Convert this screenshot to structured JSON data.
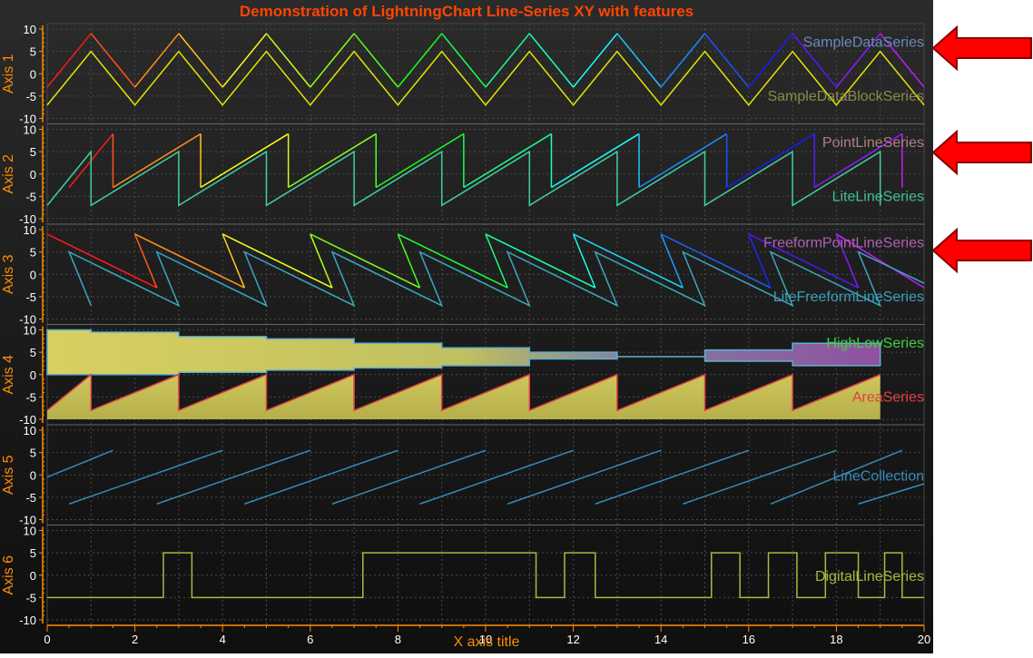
{
  "chart_data": {
    "type": "line",
    "title": "Demonstration of LightningChart Line-Series XY with features",
    "xlabel": "X axis title",
    "xlim": [
      0,
      20
    ],
    "x_ticks": [
      "0",
      "2",
      "4",
      "6",
      "8",
      "10",
      "12",
      "14",
      "16",
      "18",
      "20"
    ],
    "y_ticks": [
      "10",
      "5",
      "0",
      "-5",
      "-10"
    ],
    "grid": true,
    "colors": {
      "accent": "#ff7f00",
      "title": "#ff4500",
      "background": "#1e1e1e",
      "arrow": "#ff0000"
    },
    "axes": [
      {
        "label": "Axis 1",
        "ylim": [
          -10,
          10
        ],
        "series": [
          {
            "name": "SampleDataSeries",
            "color": "#6a8ab8",
            "rainbow": true,
            "x": [
              0,
              1,
              2,
              3,
              4,
              5,
              6,
              7,
              8,
              9,
              10,
              11,
              12,
              13,
              14,
              15,
              16,
              17,
              18,
              19,
              20
            ],
            "y": [
              -3,
              9,
              -3,
              9,
              -3,
              9,
              -3,
              9,
              -3,
              9,
              -3,
              9,
              -3,
              9,
              -3,
              9,
              -3,
              9,
              -3,
              9,
              -3
            ]
          },
          {
            "name": "SampleDataBlockSeries",
            "color": "#8a8a4a",
            "stroke": "#e6e600",
            "x": [
              0,
              1,
              2,
              3,
              4,
              5,
              6,
              7,
              8,
              9,
              10,
              11,
              12,
              13,
              14,
              15,
              16,
              17,
              18,
              19,
              20
            ],
            "y": [
              -7,
              5,
              -7,
              5,
              -7,
              5,
              -7,
              5,
              -7,
              5,
              -7,
              5,
              -7,
              5,
              -7,
              5,
              -7,
              5,
              -7,
              5,
              -7
            ]
          }
        ]
      },
      {
        "label": "Axis 2",
        "ylim": [
          -10,
          10
        ],
        "series": [
          {
            "name": "PointLineSeries",
            "color": "#b08080",
            "rainbow": true,
            "x": [
              0.5,
              1.5,
              1.5,
              3.5,
              3.5,
              5.5,
              5.5,
              7.5,
              7.5,
              9.5,
              9.5,
              11.5,
              11.5,
              13.5,
              13.5,
              15.5,
              15.5,
              17.5,
              17.5,
              19.5,
              19.5
            ],
            "y": [
              -3,
              9,
              -3,
              9,
              -3,
              9,
              -3,
              9,
              -3,
              9,
              -3,
              9,
              -3,
              9,
              -3,
              9,
              -3,
              9,
              -3,
              9,
              -3
            ]
          },
          {
            "name": "LiteLineSeries",
            "color": "#40c090",
            "stroke": "#40d0a0",
            "x": [
              0,
              1,
              1,
              3,
              3,
              5,
              5,
              7,
              7,
              9,
              9,
              11,
              11,
              13,
              13,
              15,
              15,
              17,
              17,
              19,
              19
            ],
            "y": [
              -7,
              5,
              -7,
              5,
              -7,
              5,
              -7,
              5,
              -7,
              5,
              -7,
              5,
              -7,
              5,
              -7,
              5,
              -7,
              5,
              -7,
              5,
              -7
            ]
          }
        ]
      },
      {
        "label": "Axis 3",
        "ylim": [
          -10,
          10
        ],
        "series": [
          {
            "name": "FreeformPointLineSeries",
            "color": "#b060b0",
            "rainbow": true,
            "x": [
              0,
              2.5,
              2,
              4.5,
              4,
              6.5,
              6,
              8.5,
              8,
              10.5,
              10,
              12.5,
              12,
              14.5,
              14,
              16.5,
              16,
              18.5,
              18,
              20
            ],
            "y": [
              9,
              -3,
              9,
              -3,
              9,
              -3,
              9,
              -3,
              9,
              -3,
              9,
              -3,
              9,
              -3,
              9,
              -3,
              9,
              -3,
              9,
              -3
            ]
          },
          {
            "name": "LiteFreeformLineSeries",
            "color": "#3aa0b8",
            "stroke": "#3aa8c0",
            "x": [
              1,
              0.5,
              3,
              2.5,
              5,
              4.5,
              7,
              6.5,
              9,
              8.5,
              11,
              10.5,
              13,
              12.5,
              15,
              14.5,
              17,
              16.5,
              19,
              18.5,
              20
            ],
            "y": [
              -7,
              5,
              -7,
              5,
              -7,
              5,
              -7,
              5,
              -7,
              5,
              -7,
              5,
              -7,
              5,
              -7,
              5,
              -7,
              5,
              -7,
              5,
              -2
            ]
          }
        ]
      },
      {
        "label": "Axis 4",
        "ylim": [
          -10,
          10
        ],
        "series": [
          {
            "name": "HighLowSeries",
            "color": "#40d040",
            "x": [
              0,
              1,
              3,
              5,
              7,
              9,
              11,
              13,
              15,
              17,
              19
            ],
            "high": [
              10,
              9.5,
              8.5,
              8,
              7,
              6,
              5,
              4,
              5.5,
              7,
              8
            ],
            "low": [
              0,
              0,
              0.5,
              1,
              1.5,
              2,
              3.5,
              4,
              3,
              2,
              1.5
            ]
          },
          {
            "name": "AreaSeries",
            "color": "#e04040",
            "x": [
              0,
              1,
              1,
              3,
              3,
              5,
              5,
              7,
              7,
              9,
              9,
              11,
              11,
              13,
              13,
              15,
              15,
              17,
              17,
              19
            ],
            "y": [
              -8,
              0,
              -8,
              0,
              -8,
              0,
              -8,
              0,
              -8,
              0,
              -8,
              0,
              -8,
              0,
              -8,
              0,
              -8,
              0,
              -8,
              0
            ],
            "baseline": -10
          }
        ]
      },
      {
        "label": "Axis 5",
        "ylim": [
          -10,
          10
        ],
        "series": [
          {
            "name": "LineCollection",
            "color": "#3a8ab8",
            "segments": [
              [
                0,
                -0.5,
                1.5,
                5.5
              ],
              [
                0.5,
                -6.5,
                4,
                5.5
              ],
              [
                2.5,
                -6.5,
                6,
                5.5
              ],
              [
                4.5,
                -6.5,
                8,
                5.5
              ],
              [
                6.5,
                -6.5,
                10,
                5.5
              ],
              [
                8.5,
                -6.5,
                12,
                5.5
              ],
              [
                10.5,
                -6.5,
                14,
                5.5
              ],
              [
                12.5,
                -6.5,
                16,
                5.5
              ],
              [
                14.5,
                -6.5,
                18,
                5.5
              ],
              [
                16.5,
                -6.5,
                19.5,
                5.5
              ],
              [
                18.5,
                -6.5,
                20,
                -2
              ]
            ]
          }
        ]
      },
      {
        "label": "Axis 6",
        "ylim": [
          -10,
          10
        ],
        "series": [
          {
            "name": "DigitalLineSeries",
            "color": "#a8b840",
            "transitions": [
              0,
              2.65,
              3.3,
              7.2,
              11.15,
              11.8,
              12.5,
              14.5,
              15.15,
              15.8,
              16.45,
              17.1,
              17.75,
              18.5,
              19.1,
              19.5,
              20
            ],
            "levels": [
              -5,
              5,
              -5,
              5,
              -5,
              5,
              -5,
              -5,
              5,
              -5,
              5,
              -5,
              5,
              -5,
              5,
              -5
            ]
          }
        ]
      }
    ]
  }
}
